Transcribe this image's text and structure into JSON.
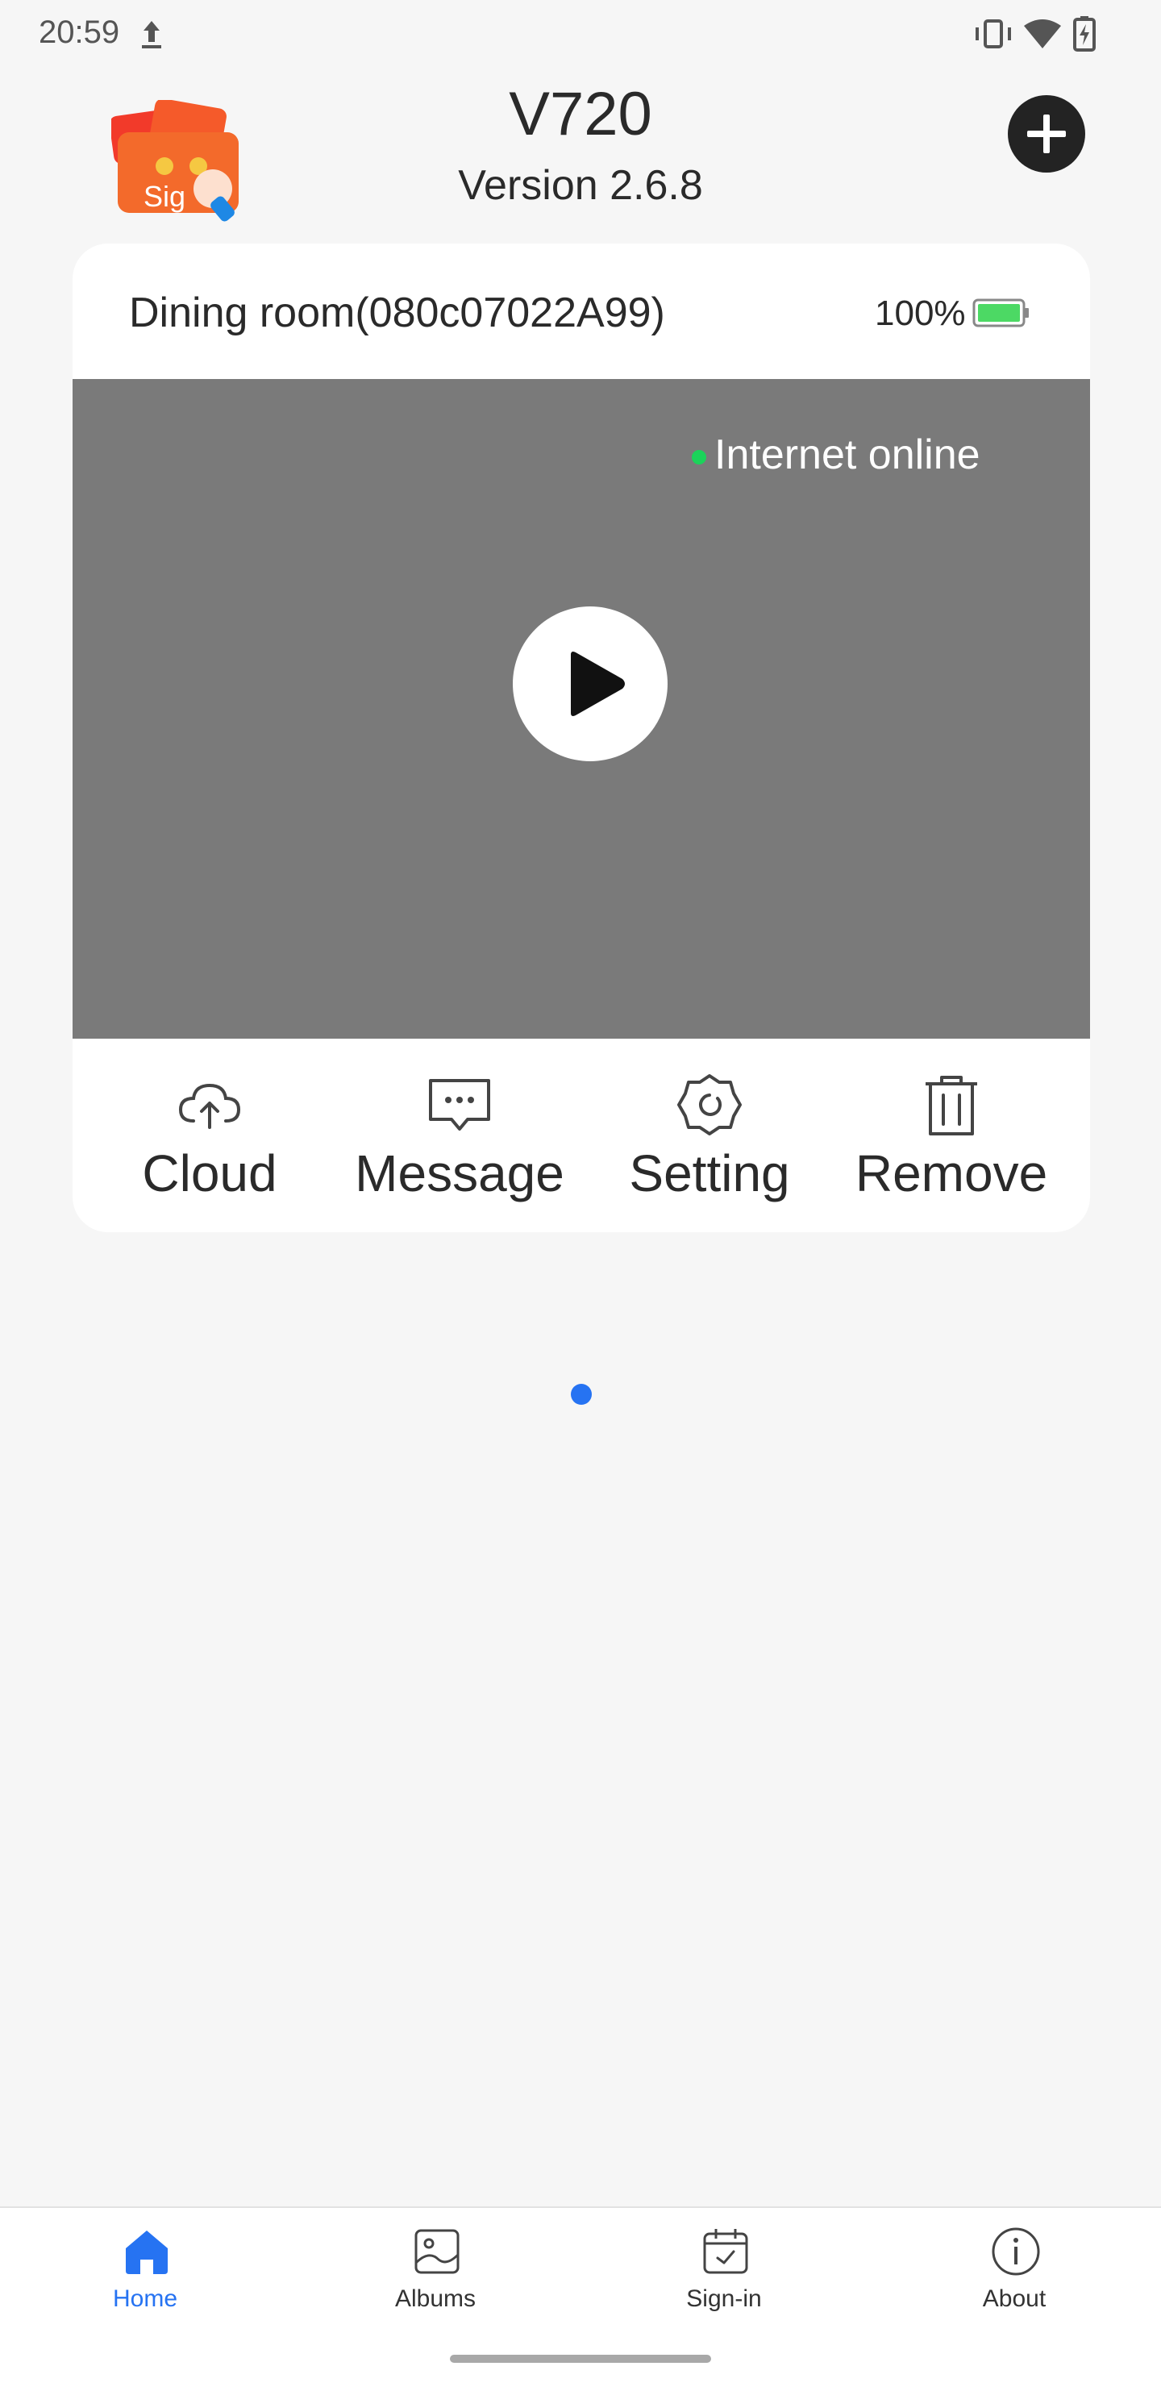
{
  "status_bar": {
    "time": "20:59",
    "icons": [
      "upload-icon",
      "vibrate-icon",
      "wifi-icon",
      "battery-charging-icon"
    ]
  },
  "header": {
    "title": "V720",
    "version": "Version 2.6.8",
    "signin_badge_text": "Sig",
    "add_icon": "plus-icon"
  },
  "device": {
    "name": "Dining room(080c07022A99)",
    "battery": "100%",
    "battery_level": 1.0,
    "status": "Internet online",
    "status_color": "#1bd35a",
    "play_icon": "play-icon"
  },
  "actions": [
    {
      "label": "Cloud",
      "icon": "cloud-upload-icon"
    },
    {
      "label": "Message",
      "icon": "message-icon"
    },
    {
      "label": "Setting",
      "icon": "gear-icon"
    },
    {
      "label": "Remove",
      "icon": "trash-icon"
    }
  ],
  "pager": {
    "active_color": "#2673f2"
  },
  "bottom_nav": [
    {
      "label": "Home",
      "icon": "home-icon",
      "active": true
    },
    {
      "label": "Albums",
      "icon": "albums-icon",
      "active": false
    },
    {
      "label": "Sign-in",
      "icon": "calendar-check-icon",
      "active": false
    },
    {
      "label": "About",
      "icon": "info-icon",
      "active": false
    }
  ],
  "colors": {
    "accent": "#2673f2",
    "battery_fill": "#4cd964"
  }
}
